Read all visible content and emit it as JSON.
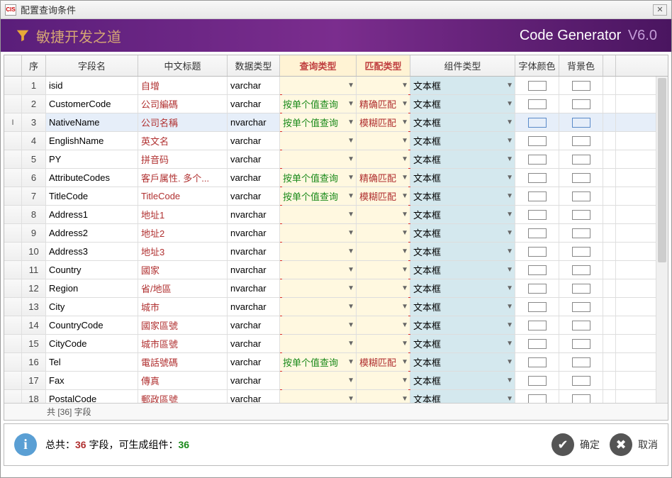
{
  "window": {
    "title": "配置查询条件",
    "icon": "CIS"
  },
  "banner": {
    "slogan": "敏捷开发之道",
    "product": "Code Generator",
    "version": "V6.0"
  },
  "headers": {
    "num": "序",
    "field": "字段名",
    "cn": "中文标题",
    "type": "数据类型",
    "query": "查询类型",
    "match": "匹配类型",
    "ctrl": "组件类型",
    "fc": "字体颜色",
    "bc": "背景色"
  },
  "rows": [
    {
      "n": "1",
      "field": "isid",
      "cn": "自增",
      "type": "varchar",
      "query": "",
      "match": "",
      "ctrl": "文本框"
    },
    {
      "n": "2",
      "field": "CustomerCode",
      "cn": "公司編碼",
      "type": "varchar",
      "query": "按单个值查询",
      "match": "精确匹配",
      "ctrl": "文本框"
    },
    {
      "n": "3",
      "field": "NativeName",
      "cn": "公司名稱",
      "type": "nvarchar",
      "query": "按单个值查询",
      "match": "模糊匹配",
      "ctrl": "文本框",
      "selected": true,
      "ind": "I"
    },
    {
      "n": "4",
      "field": "EnglishName",
      "cn": "英文名",
      "type": "varchar",
      "query": "",
      "match": "",
      "ctrl": "文本框"
    },
    {
      "n": "5",
      "field": "PY",
      "cn": "拼音码",
      "type": "varchar",
      "query": "",
      "match": "",
      "ctrl": "文本框"
    },
    {
      "n": "6",
      "field": "AttributeCodes",
      "cn": "客戶属性. 多个...",
      "type": "varchar",
      "query": "按单个值查询",
      "match": "精确匹配",
      "ctrl": "文本框"
    },
    {
      "n": "7",
      "field": "TitleCode",
      "cn": "TitleCode",
      "type": "varchar",
      "query": "按单个值查询",
      "match": "模糊匹配",
      "ctrl": "文本框"
    },
    {
      "n": "8",
      "field": "Address1",
      "cn": "地址1",
      "type": "nvarchar",
      "query": "",
      "match": "",
      "ctrl": "文本框"
    },
    {
      "n": "9",
      "field": "Address2",
      "cn": "地址2",
      "type": "nvarchar",
      "query": "",
      "match": "",
      "ctrl": "文本框"
    },
    {
      "n": "10",
      "field": "Address3",
      "cn": "地址3",
      "type": "nvarchar",
      "query": "",
      "match": "",
      "ctrl": "文本框"
    },
    {
      "n": "11",
      "field": "Country",
      "cn": "國家",
      "type": "nvarchar",
      "query": "",
      "match": "",
      "ctrl": "文本框"
    },
    {
      "n": "12",
      "field": "Region",
      "cn": "省/地區",
      "type": "nvarchar",
      "query": "",
      "match": "",
      "ctrl": "文本框"
    },
    {
      "n": "13",
      "field": "City",
      "cn": "城市",
      "type": "nvarchar",
      "query": "",
      "match": "",
      "ctrl": "文本框"
    },
    {
      "n": "14",
      "field": "CountryCode",
      "cn": "國家區號",
      "type": "varchar",
      "query": "",
      "match": "",
      "ctrl": "文本框"
    },
    {
      "n": "15",
      "field": "CityCode",
      "cn": "城市區號",
      "type": "varchar",
      "query": "",
      "match": "",
      "ctrl": "文本框"
    },
    {
      "n": "16",
      "field": "Tel",
      "cn": "電話號碼",
      "type": "varchar",
      "query": "按单个值查询",
      "match": "模糊匹配",
      "ctrl": "文本框"
    },
    {
      "n": "17",
      "field": "Fax",
      "cn": "傳真",
      "type": "varchar",
      "query": "",
      "match": "",
      "ctrl": "文本框"
    },
    {
      "n": "18",
      "field": "PostalCode",
      "cn": "郵政區號",
      "type": "varchar",
      "query": "",
      "match": "",
      "ctrl": "文本框"
    }
  ],
  "footer": {
    "text": "共 [36] 字段"
  },
  "summary": {
    "prefix": "总共：",
    "count": "36",
    "mid": "  字段，可生成组件：",
    "count2": "36"
  },
  "buttons": {
    "ok": "确定",
    "cancel": "取消"
  }
}
